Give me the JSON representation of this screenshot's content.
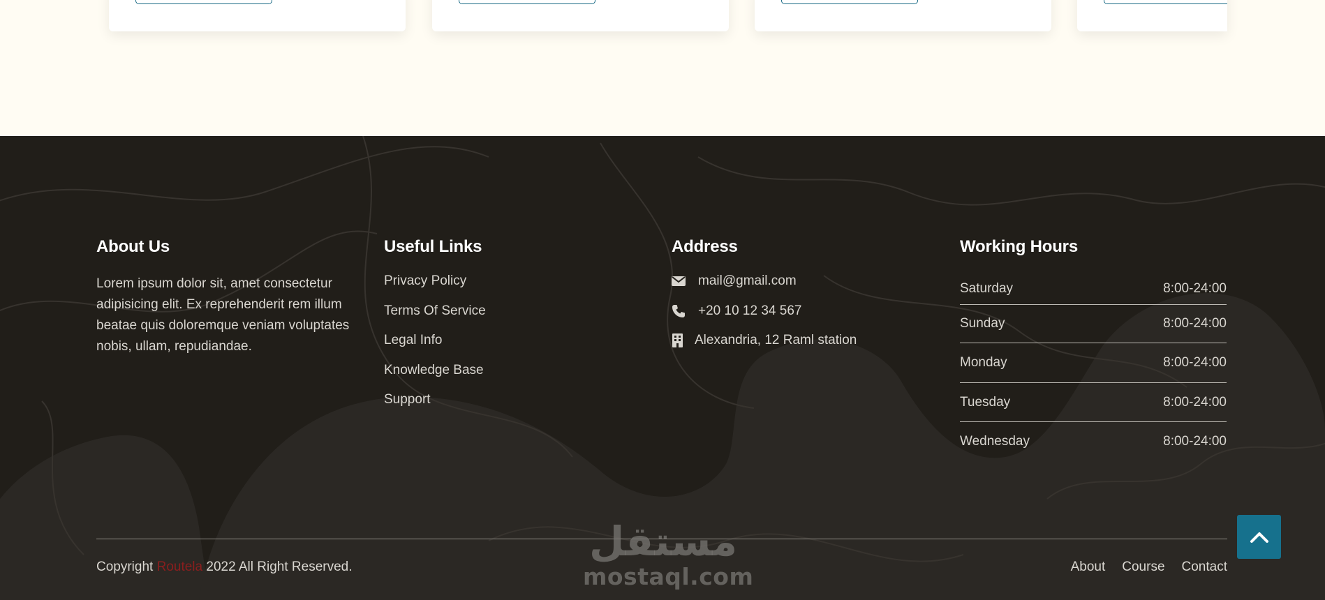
{
  "footer": {
    "about": {
      "title": "About Us",
      "text": "Lorem ipsum dolor sit, amet consectetur adipisicing elit. Ex reprehenderit rem illum beatae quis doloremque veniam voluptates nobis, ullam, repudiandae."
    },
    "links": {
      "title": "Useful Links",
      "items": [
        "Privacy Policy",
        "Terms Of Service",
        "Legal Info",
        "Knowledge Base",
        "Support"
      ]
    },
    "address": {
      "title": "Address",
      "email": "mail@gmail.com",
      "phone": "+20 10 12 34 567",
      "location": "Alexandria, 12 Raml station",
      "icons": [
        "envelope-icon",
        "phone-icon",
        "building-icon"
      ]
    },
    "hours": {
      "title": "Working Hours",
      "rows": [
        {
          "day": "Saturday",
          "time": "8:00-24:00"
        },
        {
          "day": "Sunday",
          "time": "8:00-24:00"
        },
        {
          "day": "Monday",
          "time": "8:00-24:00"
        },
        {
          "day": "Tuesday",
          "time": "8:00-24:00"
        },
        {
          "day": "Wednesday",
          "time": "8:00-24:00"
        }
      ]
    },
    "copyright": {
      "prefix": "Copyright ",
      "brand": "Routela",
      "suffix": " 2022 All Right Reserved."
    },
    "nav": [
      "About",
      "Course",
      "Contact"
    ]
  },
  "watermark": {
    "arabic": "مستقل",
    "latin": "mostaql.com"
  },
  "scroll_top": {
    "icon": "chevron-up-icon"
  },
  "colors": {
    "footer_bg": "#211e19",
    "page_bg": "#fffcf3",
    "accent": "#16718d",
    "brand": "#8b1e1e"
  }
}
